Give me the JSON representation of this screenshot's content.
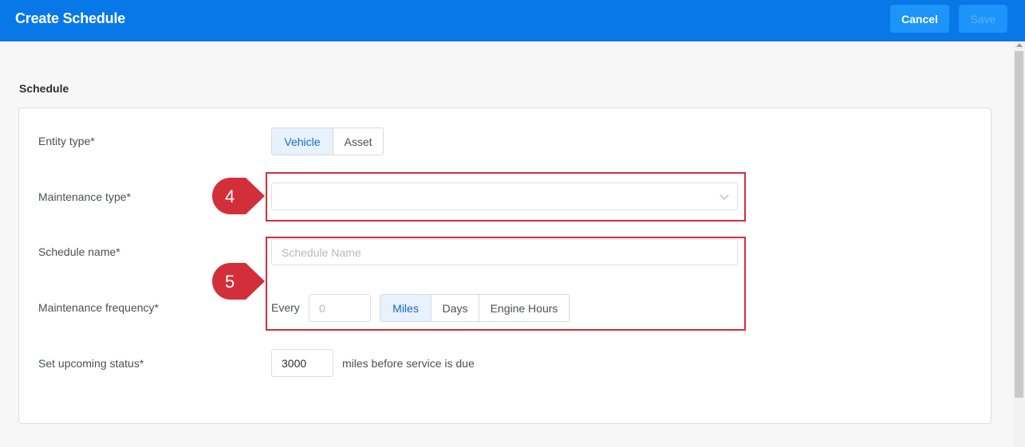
{
  "header": {
    "title": "Create Schedule",
    "cancel_label": "Cancel",
    "save_label": "Save"
  },
  "section_title": "Schedule",
  "form": {
    "entity_type": {
      "label": "Entity type*",
      "options": [
        "Vehicle",
        "Asset"
      ],
      "selected": "Vehicle"
    },
    "maintenance_type": {
      "label": "Maintenance type*",
      "value": ""
    },
    "schedule_name": {
      "label": "Schedule name*",
      "placeholder": "Schedule Name"
    },
    "maintenance_frequency": {
      "label": "Maintenance frequency*",
      "prefix": "Every",
      "placeholder": "0",
      "units": [
        "Miles",
        "Days",
        "Engine Hours"
      ],
      "selected_unit": "Miles"
    },
    "upcoming_status": {
      "label": "Set upcoming status*",
      "value": "3000",
      "suffix": "miles before service is due"
    }
  },
  "annotations": {
    "marker_4": "4",
    "marker_5": "5",
    "color": "#d22f3a"
  },
  "colors": {
    "header_bg": "#0877e8",
    "button_bg": "#1c94f9",
    "active_segment_bg": "#e7f2fd",
    "active_segment_text": "#1b67c9"
  }
}
